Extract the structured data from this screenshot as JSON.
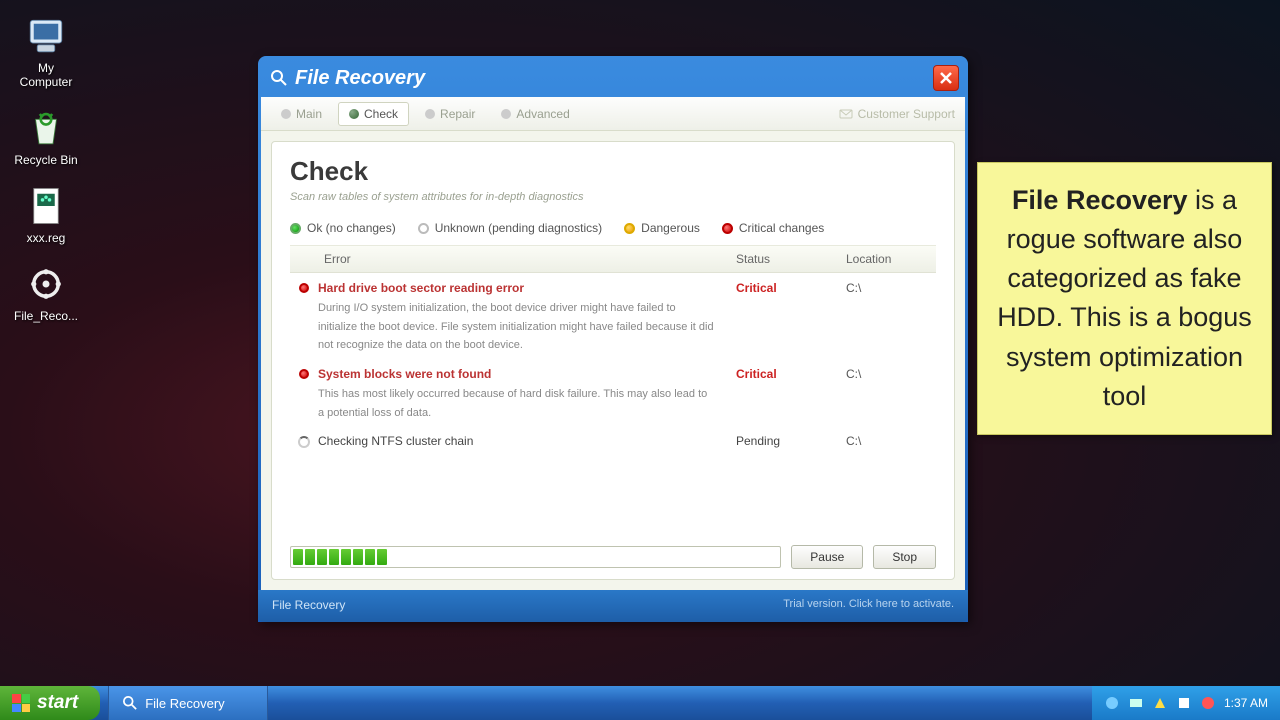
{
  "desktop": {
    "icons": [
      {
        "label": "My Computer",
        "name": "my-computer-icon"
      },
      {
        "label": "Recycle Bin",
        "name": "recycle-bin-icon"
      },
      {
        "label": "xxx.reg",
        "name": "reg-file-icon"
      },
      {
        "label": "File_Reco...",
        "name": "file-recovery-shortcut-icon"
      }
    ]
  },
  "window": {
    "title": "File Recovery",
    "tabs": [
      {
        "label": "Main",
        "active": false
      },
      {
        "label": "Check",
        "active": true
      },
      {
        "label": "Repair",
        "active": false
      },
      {
        "label": "Advanced",
        "active": false
      }
    ],
    "support": "Customer Support",
    "panel": {
      "heading": "Check",
      "subtitle": "Scan raw tables of system attributes for in-depth diagnostics"
    },
    "legend": [
      {
        "color": "green",
        "label": "Ok (no changes)"
      },
      {
        "color": "grey",
        "label": "Unknown (pending diagnostics)"
      },
      {
        "color": "orange",
        "label": "Dangerous"
      },
      {
        "color": "red",
        "label": "Critical changes"
      }
    ],
    "columns": {
      "error": "Error",
      "status": "Status",
      "location": "Location"
    },
    "rows": [
      {
        "severity": "red",
        "title": "Hard drive boot sector reading error",
        "desc": "During I/O system initialization, the boot device driver might have failed to initialize the boot device. File system initialization might have failed because it did not recognize the data on the boot device.",
        "status": "Critical",
        "location": "C:\\"
      },
      {
        "severity": "red",
        "title": "System blocks were not found",
        "desc": "This has most likely occurred because of hard disk failure. This may also lead to a potential loss of data.",
        "status": "Critical",
        "location": "C:\\"
      },
      {
        "severity": "spinner",
        "title": "Checking NTFS cluster chain",
        "desc": "",
        "status": "Pending",
        "location": "C:\\"
      }
    ],
    "progress_segments": 8,
    "buttons": {
      "pause": "Pause",
      "stop": "Stop"
    },
    "footer": {
      "brand": "File Recovery",
      "trial": "Trial version. Click here to activate."
    }
  },
  "callout": {
    "strong": "File Recovery",
    "text": " is a rogue software also categorized as fake HDD. This is a bogus system optimization tool"
  },
  "taskbar": {
    "start": "start",
    "task": "File Recovery",
    "clock": "1:37 AM"
  }
}
